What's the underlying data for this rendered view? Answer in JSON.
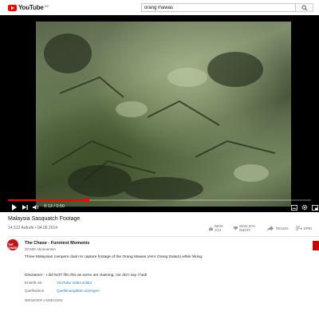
{
  "masthead": {
    "logo_text": "YouTube",
    "logo_country": "DE",
    "search": {
      "value": "orang mawas",
      "placeholder": ""
    }
  },
  "player": {
    "time": "0:13 / 0:50",
    "progress_fraction": 0.26
  },
  "video": {
    "title": "Malaysia Sasquatch Footage",
    "views_date": "14.512 Aufrufe • 04.06.2014",
    "actions": {
      "like": "MAG ICH",
      "dislike": "MAG ICH NICHT",
      "share": "TEILEN",
      "save": "SPEI"
    }
  },
  "channel": {
    "avatar_text": "THE CHASE",
    "name": "The Chase - Funniest Moments",
    "subscribers": "20.600 Abonnenten"
  },
  "description": {
    "text1": "Three Malaysian campers claim to capture footage of the Orang Mawas (AKA Orang Dalam) while hiking.",
    "text2": "Disclaimer - I did NOT film this as some are claiming, nor did I say I had!",
    "created_label": "Erstellt mit",
    "created_value": "YouTube Video Editor",
    "sources_label": "Quellvideos",
    "sources_value": "Quellenangaben anzeigen",
    "show_less": "WENIGER ANZEIGEN"
  },
  "colors": {
    "brand_red": "#ff0000",
    "link_blue": "#167ac6"
  }
}
